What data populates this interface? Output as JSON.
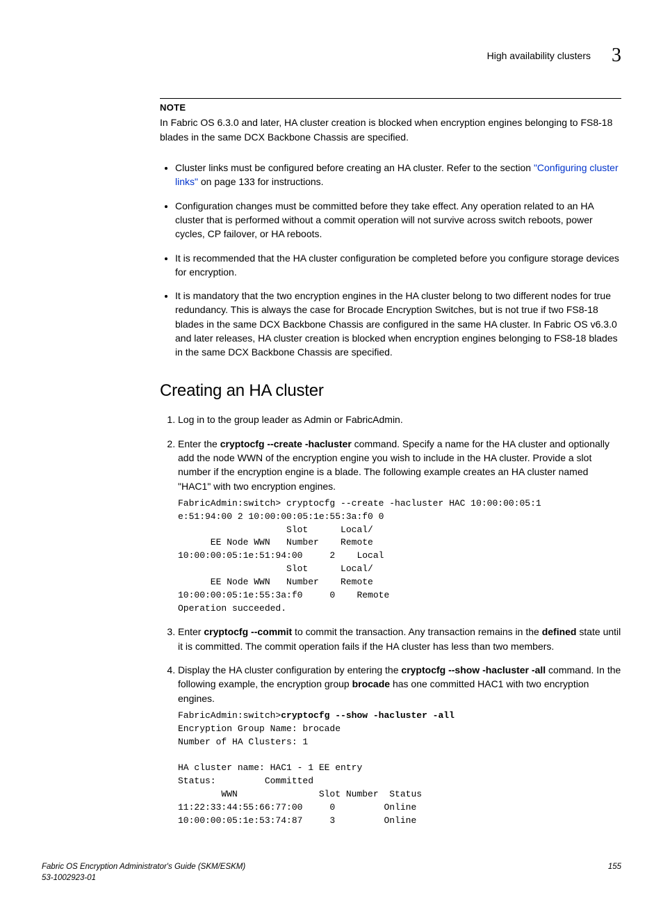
{
  "header": {
    "title": "High availability clusters",
    "chapter": "3"
  },
  "note": {
    "label": "NOTE",
    "text": "In Fabric OS 6.3.0 and later, HA cluster creation is blocked when encryption engines belonging to FS8-18 blades in the same DCX Backbone Chassis are specified."
  },
  "bullets": {
    "b1_pre": "Cluster links must be configured before creating an HA cluster. Refer to the section ",
    "b1_link": "\"Configuring cluster links\"",
    "b1_post": " on page 133 for instructions.",
    "b2": "Configuration changes must be committed before they take effect. Any operation related to an HA cluster that is performed without a commit operation will not survive across switch reboots, power cycles, CP failover, or HA reboots.",
    "b3": "It is recommended that the HA cluster configuration be completed before you configure storage devices for encryption.",
    "b4": "It is mandatory that the two encryption engines in the HA cluster belong to two different nodes for true redundancy. This is always the case for Brocade Encryption Switches, but is not true if two FS8-18 blades in the same DCX Backbone Chassis are configured in the same HA cluster. In Fabric OS v6.3.0 and later releases, HA cluster creation is blocked when encryption engines belonging to FS8-18 blades in the same DCX Backbone Chassis are specified."
  },
  "section_title": "Creating an HA cluster",
  "steps": {
    "s1": "Log in to the group leader as Admin or FabricAdmin.",
    "s2_pre": "Enter the ",
    "s2_cmd1": "cryptocfg",
    "s2_cmd2": "--create",
    "s2_cmd3": "-hacluster",
    "s2_post": " command. Specify a name for the HA cluster and optionally add the node WWN of the encryption engine you wish to include in the HA cluster. Provide a slot number if the encryption engine is a blade. The following example creates an HA cluster named \"HAC1\" with two encryption engines.",
    "s2_code": "FabricAdmin:switch> cryptocfg --create -hacluster HAC 10:00:00:05:1\ne:51:94:00 2 10:00:00:05:1e:55:3a:f0 0\n                    Slot      Local/\n      EE Node WWN   Number    Remote\n10:00:00:05:1e:51:94:00     2    Local\n                    Slot      Local/\n      EE Node WWN   Number    Remote\n10:00:00:05:1e:55:3a:f0     0    Remote\nOperation succeeded.",
    "s3_pre": "Enter ",
    "s3_cmd1": "cryptocfg",
    "s3_cmd2": "--commit",
    "s3_mid": " to commit the transaction. Any transaction remains in the ",
    "s3_bold": "defined",
    "s3_post": " state until it is committed. The commit operation fails if the HA cluster has less than two members.",
    "s4_pre": "Display the HA cluster configuration by entering the ",
    "s4_cmd1": "cryptocfg",
    "s4_cmd2": "--show",
    "s4_cmd3": "-hacluster",
    "s4_cmd4": "-all",
    "s4_cmd_tail": " command",
    "s4_mid": ". In the following example, the encryption group ",
    "s4_bold": "brocade",
    "s4_post": " has one committed HAC1 with two encryption engines.",
    "s4_code_pre": "FabricAdmin:switch>",
    "s4_code_bold": "cryptocfg --show -hacluster -all",
    "s4_code_rest": "\nEncryption Group Name: brocade\nNumber of HA Clusters: 1\n\nHA cluster name: HAC1 - 1 EE entry\nStatus:         Committed\n        WWN               Slot Number  Status\n11:22:33:44:55:66:77:00     0         Online\n10:00:00:05:1e:53:74:87     3         Online"
  },
  "footer": {
    "left1": "Fabric OS Encryption Administrator's Guide (SKM/ESKM)",
    "left2": "53-1002923-01",
    "right": "155"
  }
}
